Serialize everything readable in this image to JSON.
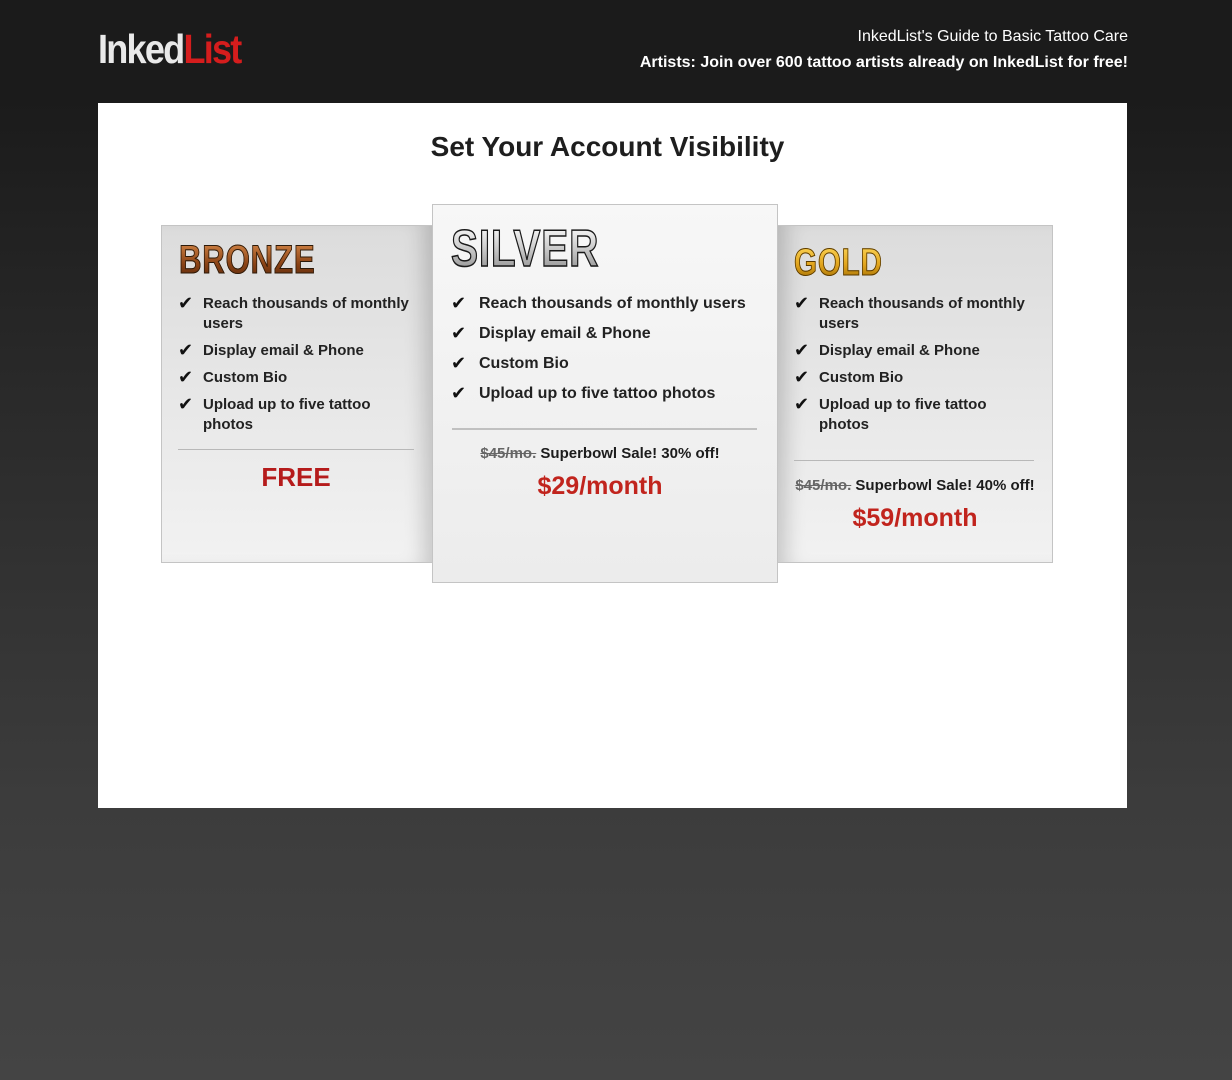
{
  "header": {
    "logo_part1": "Inked",
    "logo_part2": "List",
    "guide_link": "InkedList's Guide to Basic Tattoo Care",
    "artists_cta": "Artists: Join over 600 tattoo artists already on InkedList for free!"
  },
  "main": {
    "title": "Set Your Account Visibility"
  },
  "plans": {
    "bronze": {
      "name": "BRONZE",
      "features": [
        "Reach thousands of monthly users",
        "Display email & Phone",
        "Custom Bio",
        "Upload up to five tattoo photos"
      ],
      "price": "FREE"
    },
    "silver": {
      "name": "SILVER",
      "features": [
        "Reach thousands of monthly users",
        "Display email & Phone",
        "Custom Bio",
        "Upload up to five tattoo photos"
      ],
      "old_price": "$45/mo.",
      "sale_text": "Superbowl Sale! 30% off!",
      "price": "$29/month"
    },
    "gold": {
      "name": "GOLD",
      "features": [
        "Reach thousands of monthly users",
        "Display email & Phone",
        "Custom Bio",
        "Upload up to five tattoo photos"
      ],
      "old_price": "$45/mo.",
      "sale_text": "Superbowl Sale! 40% off!",
      "price": "$59/month"
    }
  },
  "icons": {
    "check": "check-icon"
  },
  "colors": {
    "brand_red": "#d51d1d",
    "price_red": "#c1241d",
    "header_bg": "#1b1b1b"
  }
}
